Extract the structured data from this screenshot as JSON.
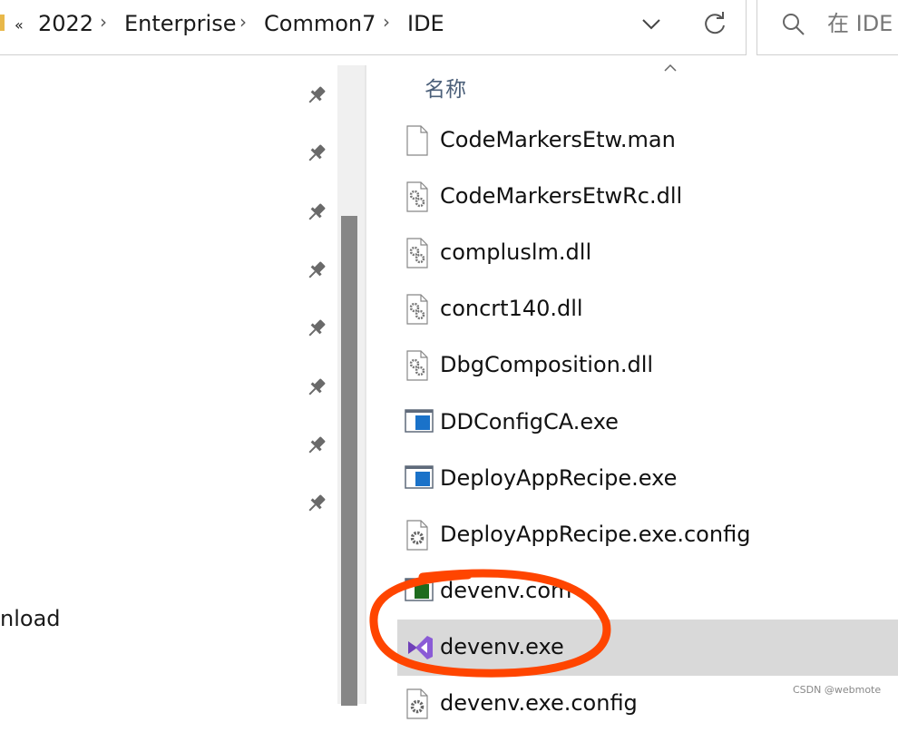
{
  "breadcrumb": {
    "overflow": "«",
    "separator": "›",
    "items": [
      "2022",
      "Enterprise",
      "Common7",
      "IDE"
    ]
  },
  "search": {
    "placeholder": "在 IDE"
  },
  "nav": {
    "partial_item": "nload",
    "pin_count": 8
  },
  "file_list": {
    "column_name": "名称",
    "sort": "ascending",
    "files": [
      {
        "name": "CodeMarkersEtw.man",
        "icon": "document-icon"
      },
      {
        "name": "CodeMarkersEtwRc.dll",
        "icon": "dll-gear-icon"
      },
      {
        "name": "compluslm.dll",
        "icon": "dll-gear-icon"
      },
      {
        "name": "concrt140.dll",
        "icon": "dll-gear-icon"
      },
      {
        "name": "DbgComposition.dll",
        "icon": "dll-gear-icon"
      },
      {
        "name": "DDConfigCA.exe",
        "icon": "exe-window-icon"
      },
      {
        "name": "DeployAppRecipe.exe",
        "icon": "exe-window-icon"
      },
      {
        "name": "DeployAppRecipe.exe.config",
        "icon": "config-gear-icon"
      },
      {
        "name": "devenv.com",
        "icon": "com-console-icon"
      },
      {
        "name": "devenv.exe",
        "icon": "visual-studio-icon",
        "selected": true
      },
      {
        "name": "devenv.exe.config",
        "icon": "config-gear-icon"
      }
    ]
  },
  "colors": {
    "selection": "#d9d9d9",
    "annotation": "#ff4500",
    "vs_purple": "#8a5bd6"
  },
  "watermark": "CSDN @webmote"
}
